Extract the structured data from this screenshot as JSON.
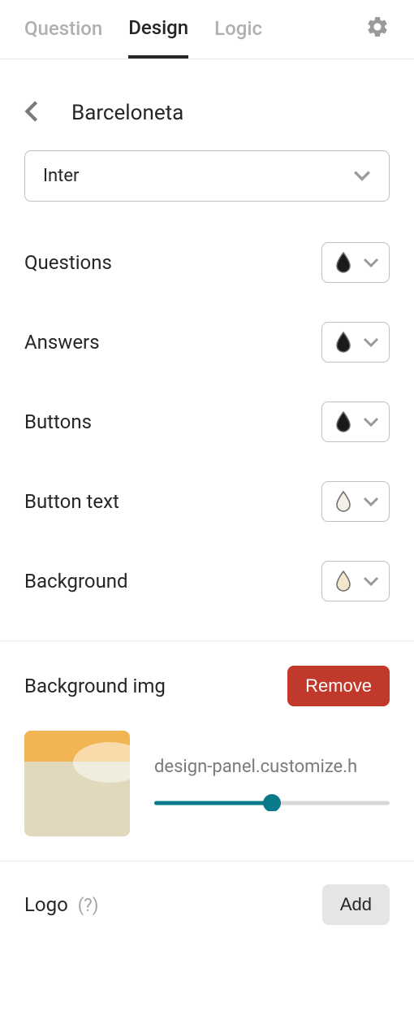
{
  "tabs": {
    "question": "Question",
    "design": "Design",
    "logic": "Logic"
  },
  "header": {
    "title": "Barceloneta"
  },
  "font": {
    "selected": "Inter"
  },
  "colors": {
    "questions": {
      "label": "Questions",
      "value": "#1a1a1a"
    },
    "answers": {
      "label": "Answers",
      "value": "#1a1a1a"
    },
    "buttons": {
      "label": "Buttons",
      "value": "#1a1a1a"
    },
    "button_text": {
      "label": "Button text",
      "value": "#f4f0e6"
    },
    "background": {
      "label": "Background",
      "value": "#f2e6cb"
    }
  },
  "background_img": {
    "label": "Background img",
    "remove_label": "Remove",
    "path": "design-panel.customize.h",
    "slider_value": 50
  },
  "logo": {
    "label": "Logo",
    "help": "(?)",
    "add_label": "Add"
  }
}
